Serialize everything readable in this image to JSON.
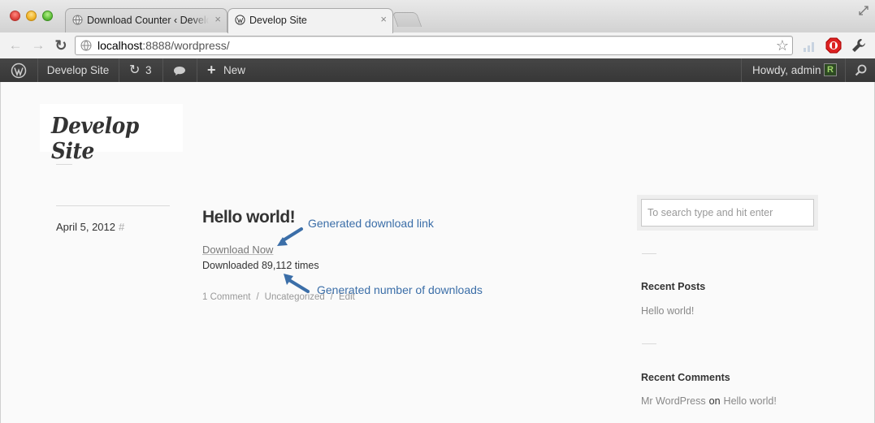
{
  "browser": {
    "tabs": [
      {
        "label": "Download Counter ‹ Develop Site",
        "active": false
      },
      {
        "label": "Develop Site",
        "active": true
      }
    ],
    "tab_close_glyph": "×",
    "url_host": "localhost",
    "url_rest": ":8888/wordpress/",
    "icons": [
      "back-arrow-icon",
      "forward-arrow-icon",
      "reload-icon",
      "globe-icon",
      "star-icon",
      "signal-icon",
      "stop-hand-icon",
      "wrench-icon"
    ]
  },
  "adminbar": {
    "site_name": "Develop Site",
    "updates_count": "3",
    "new_label": "New",
    "howdy": "Howdy, admin",
    "avatar_letter": "R",
    "colors": {
      "background": "#3b3b3b",
      "text": "#dddddd"
    }
  },
  "site": {
    "title": "Develop Site"
  },
  "post": {
    "date": "April 5, 2012",
    "permalink": "#",
    "title": "Hello world!",
    "download_link": "Download Now",
    "download_count": "Downloaded 89,112 times",
    "meta": {
      "comments": "1 Comment",
      "separator": "/",
      "category": "Uncategorized",
      "edit": "Edit"
    }
  },
  "annotations": {
    "link": "Generated download link",
    "count": "Generated number of downloads",
    "color": "#3b6ea8"
  },
  "sidebar": {
    "search_placeholder": "To search type and hit enter",
    "recent_posts_title": "Recent Posts",
    "recent_posts": [
      "Hello world!"
    ],
    "recent_comments_title": "Recent Comments",
    "recent_comment": {
      "author": "Mr WordPress",
      "on": "on",
      "post": "Hello world!"
    }
  }
}
